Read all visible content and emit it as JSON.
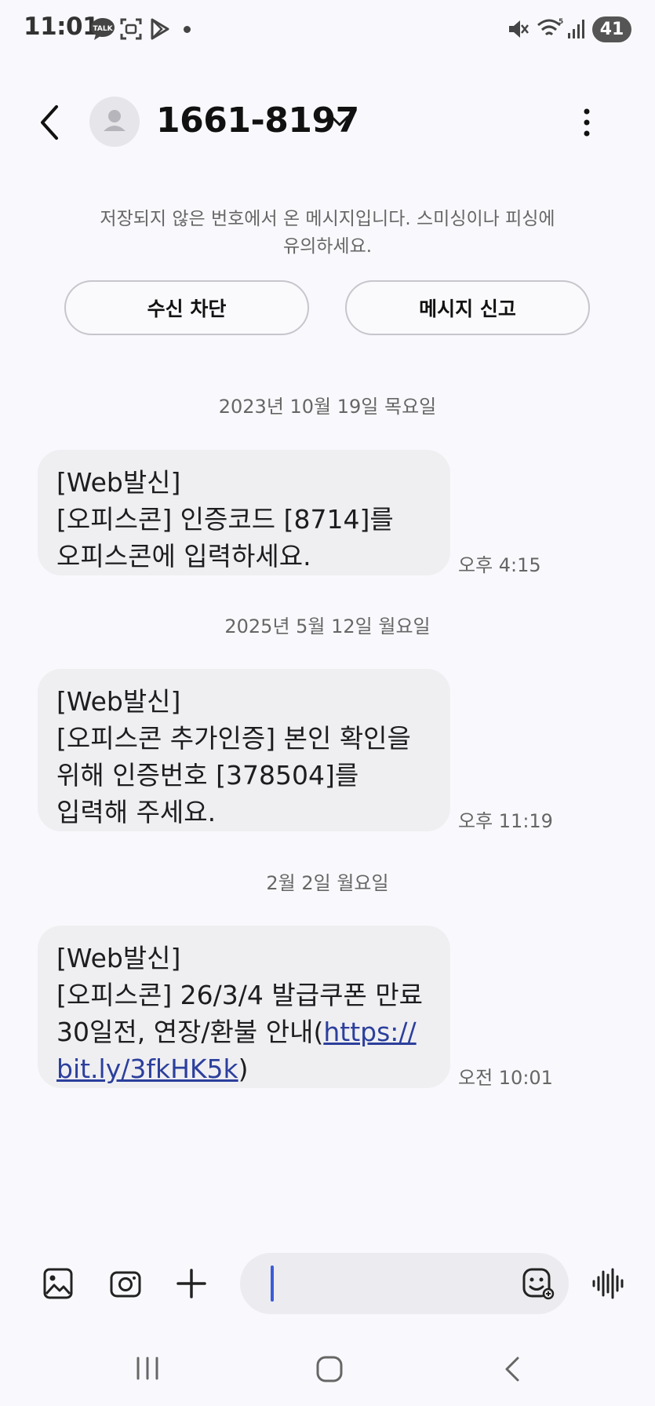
{
  "status_bar": {
    "time": "11:01",
    "battery": "41"
  },
  "header": {
    "contact": "1661-8197"
  },
  "warning": {
    "text_line1": "저장되지 않은 번호에서 온 메시지입니다. 스미싱이나 피싱에",
    "text_line2": "유의하세요.",
    "block_button": "수신 차단",
    "report_button": "메시지 신고"
  },
  "messages": [
    {
      "date": "2023년 10월 19일 목요일",
      "lines": [
        "[Web발신]",
        "[오피스콘] 인증코드 [8714]를",
        "오피스콘에 입력하세요."
      ],
      "time": "오후 4:15"
    },
    {
      "date": "2025년 5월 12일 월요일",
      "lines": [
        "[Web발신]",
        "[오피스콘 추가인증] 본인 확인을",
        "위해 인증번호 [378504]를",
        "입력해 주세요."
      ],
      "time": "오후 11:19"
    },
    {
      "date": "2월 2일 월요일",
      "lines": [
        "[Web발신]",
        "[오피스콘] 26/3/4 발급쿠폰 만료",
        "30일전, 연장/환불 안내("
      ],
      "link_part1": "https://",
      "link_part2": "bit.ly/3fkHK5k",
      "suffix": ")",
      "time": "오전 10:01"
    }
  ],
  "colors": {
    "background": "#f9f9fd",
    "bubble": "#efeff2",
    "link": "#2c3f9c",
    "cursor": "#3a5bd9"
  },
  "icons": [
    "talk-icon",
    "screenshot-icon",
    "play-store-icon",
    "mute-icon",
    "wifi-icon",
    "signal-icon",
    "back-icon",
    "person-icon",
    "chevron-down-icon",
    "more-icon",
    "image-icon",
    "camera-icon",
    "plus-icon",
    "emoji-icon",
    "voice-icon",
    "recents-icon",
    "home-icon",
    "nav-back-icon"
  ]
}
